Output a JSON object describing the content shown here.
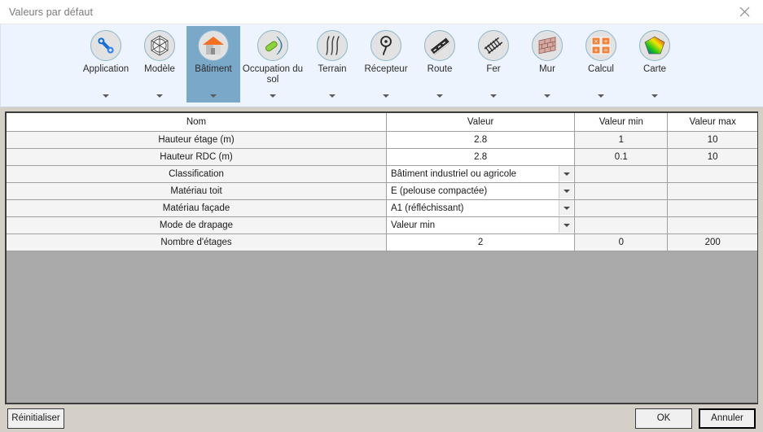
{
  "window": {
    "title": "Valeurs par défaut",
    "close_icon": "close-icon"
  },
  "ribbon": {
    "items": [
      {
        "label": "Application",
        "icon": "wrench-icon",
        "selected": false,
        "has_caret": true
      },
      {
        "label": "Modèle",
        "icon": "polyhedron-icon",
        "selected": false,
        "has_caret": true
      },
      {
        "label": "Bâtiment",
        "icon": "house-icon",
        "selected": true,
        "has_caret": true
      },
      {
        "label": "Occupation du sol",
        "icon": "landcover-icon",
        "selected": false,
        "has_caret": true
      },
      {
        "label": "Terrain",
        "icon": "contour-icon",
        "selected": false,
        "has_caret": true
      },
      {
        "label": "Récepteur",
        "icon": "receiver-icon",
        "selected": false,
        "has_caret": true
      },
      {
        "label": "Route",
        "icon": "road-icon",
        "selected": false,
        "has_caret": true
      },
      {
        "label": "Fer",
        "icon": "railway-icon",
        "selected": false,
        "has_caret": true
      },
      {
        "label": "Mur",
        "icon": "wall-icon",
        "selected": false,
        "has_caret": true
      },
      {
        "label": "Calcul",
        "icon": "calculator-icon",
        "selected": false,
        "has_caret": true
      },
      {
        "label": "Carte",
        "icon": "colormap-icon",
        "selected": false,
        "has_caret": true
      }
    ]
  },
  "grid": {
    "columns": [
      "Nom",
      "Valeur",
      "Valeur min",
      "Valeur max"
    ],
    "rows": [
      {
        "name": "Hauteur étage (m)",
        "value": "2.8",
        "type": "text",
        "min": "1",
        "max": "10"
      },
      {
        "name": "Hauteur RDC (m)",
        "value": "2.8",
        "type": "text",
        "min": "0.1",
        "max": "10"
      },
      {
        "name": "Classification",
        "value": "Bâtiment industriel ou agricole",
        "type": "combo",
        "min": "",
        "max": ""
      },
      {
        "name": "Matériau toit",
        "value": "E (pelouse compactée)",
        "type": "combo",
        "min": "",
        "max": ""
      },
      {
        "name": "Matériau façade",
        "value": "A1 (réfléchissant)",
        "type": "combo",
        "min": "",
        "max": ""
      },
      {
        "name": "Mode de drapage",
        "value": "Valeur min",
        "type": "combo",
        "min": "",
        "max": ""
      },
      {
        "name": "Nombre d'étages",
        "value": "2",
        "type": "text",
        "min": "0",
        "max": "200"
      }
    ]
  },
  "footer": {
    "reset_label": "Réinitialiser",
    "ok_label": "OK",
    "cancel_label": "Annuler"
  },
  "colors": {
    "ribbon_background": "#eef4fd",
    "selected_tab": "#7aa8c8",
    "name_text": "#107c10",
    "dialog_background": "#d4d0c8",
    "grid_filler": "#aaaaaa"
  }
}
